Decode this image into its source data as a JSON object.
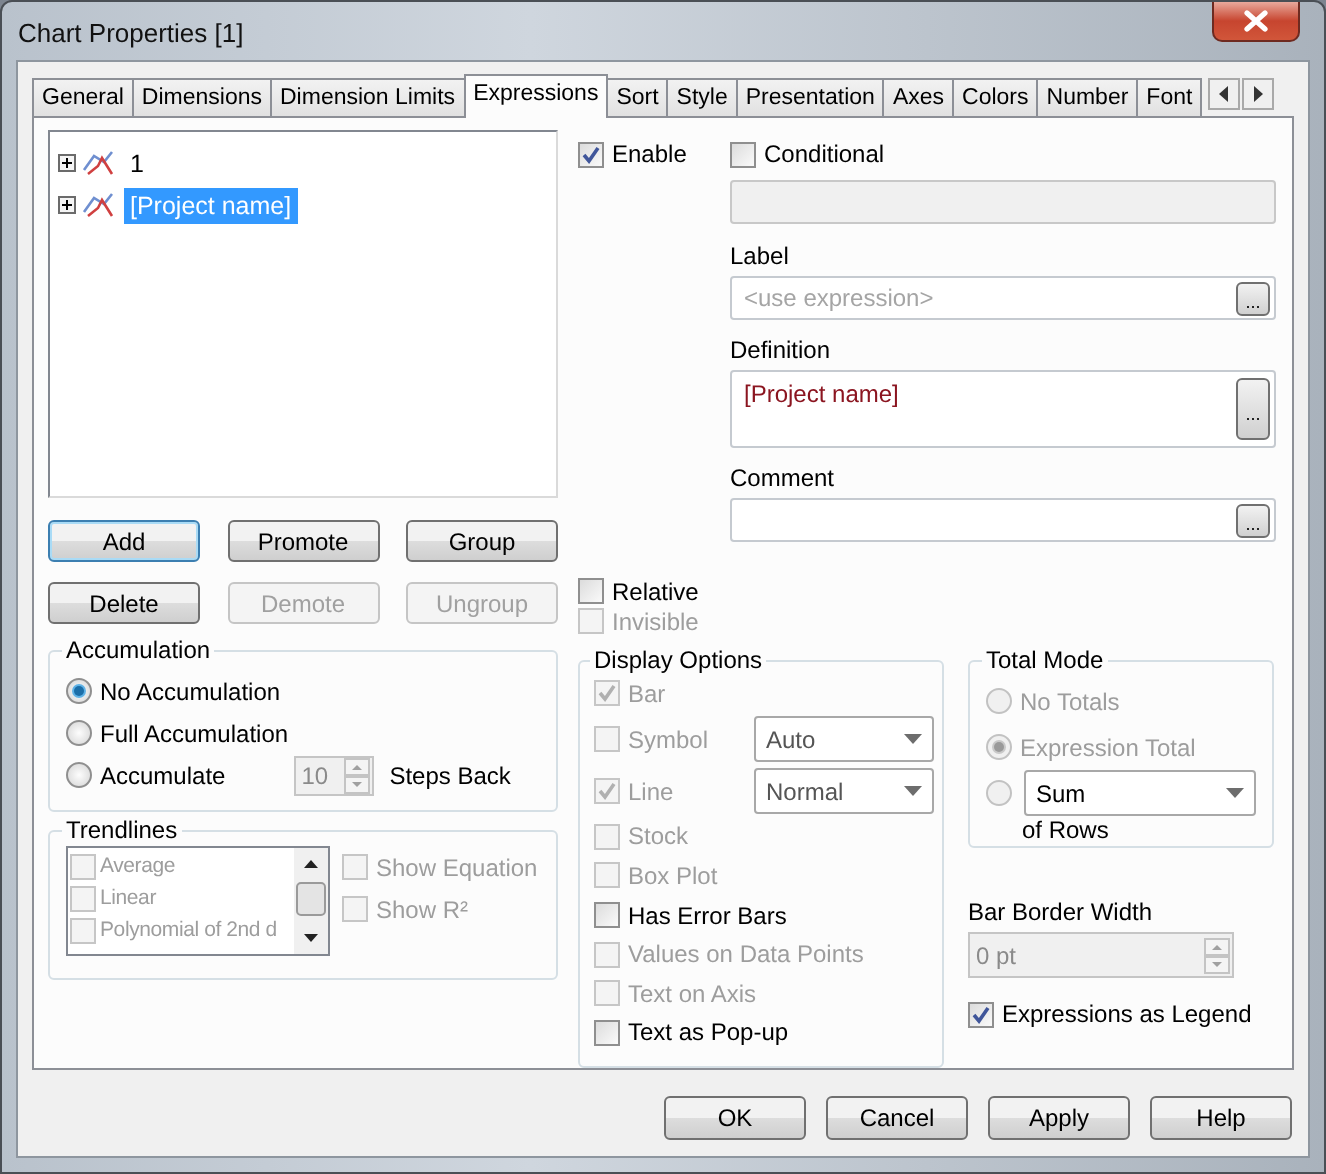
{
  "window": {
    "title": "Chart Properties [1]"
  },
  "tabs": [
    {
      "label": "General",
      "selected": false
    },
    {
      "label": "Dimensions",
      "selected": false
    },
    {
      "label": "Dimension Limits",
      "selected": false
    },
    {
      "label": "Expressions",
      "selected": true
    },
    {
      "label": "Sort",
      "selected": false
    },
    {
      "label": "Style",
      "selected": false
    },
    {
      "label": "Presentation",
      "selected": false
    },
    {
      "label": "Axes",
      "selected": false
    },
    {
      "label": "Colors",
      "selected": false
    },
    {
      "label": "Number",
      "selected": false
    },
    {
      "label": "Font",
      "selected": false
    }
  ],
  "expression_tree": [
    {
      "label": "1",
      "selected": false,
      "expanded": false
    },
    {
      "label": "[Project name]",
      "selected": true,
      "expanded": false
    }
  ],
  "tree_buttons": [
    {
      "label": "Add",
      "disabled": false,
      "focused": true
    },
    {
      "label": "Promote",
      "disabled": false,
      "focused": false
    },
    {
      "label": "Group",
      "disabled": false,
      "focused": false
    },
    {
      "label": "Delete",
      "disabled": false,
      "focused": false
    },
    {
      "label": "Demote",
      "disabled": true,
      "focused": false
    },
    {
      "label": "Ungroup",
      "disabled": true,
      "focused": false
    }
  ],
  "accumulation": {
    "title": "Accumulation",
    "options": [
      {
        "label": "No Accumulation",
        "selected": true
      },
      {
        "label": "Full Accumulation",
        "selected": false
      },
      {
        "label": "Accumulate",
        "selected": false
      }
    ],
    "steps": {
      "value": "10",
      "disabled": true
    },
    "steps_label": "Steps Back"
  },
  "trendlines": {
    "title": "Trendlines",
    "items": [
      {
        "label": "Average",
        "checked": false
      },
      {
        "label": "Linear",
        "checked": false
      },
      {
        "label": "Polynomial of 2nd d",
        "checked": false
      }
    ],
    "options": [
      {
        "label": "Show Equation",
        "checked": false,
        "disabled": true
      },
      {
        "label": "Show R²",
        "checked": false,
        "disabled": true
      }
    ]
  },
  "enable": {
    "label": "Enable",
    "checked": true
  },
  "conditional": {
    "label": "Conditional",
    "checked": false
  },
  "label_field": {
    "caption": "Label",
    "placeholder": "<use expression>",
    "button": "..."
  },
  "definition": {
    "caption": "Definition",
    "value": "[Project name]",
    "button": "..."
  },
  "comment": {
    "caption": "Comment",
    "button": "..."
  },
  "relative": {
    "label": "Relative",
    "checked": false,
    "disabled": false
  },
  "invisible": {
    "label": "Invisible",
    "checked": false,
    "disabled": true
  },
  "display_options": {
    "title": "Display Options",
    "items": [
      {
        "kind": "check",
        "label": "Bar",
        "checked": true,
        "disabled": true
      },
      {
        "kind": "check_select",
        "label": "Symbol",
        "checked": false,
        "disabled": true,
        "select": "Auto"
      },
      {
        "kind": "check_select",
        "label": "Line",
        "checked": true,
        "disabled": true,
        "select": "Normal"
      },
      {
        "kind": "check",
        "label": "Stock",
        "checked": false,
        "disabled": true
      },
      {
        "kind": "check",
        "label": "Box Plot",
        "checked": false,
        "disabled": true
      },
      {
        "kind": "check",
        "label": "Has Error Bars",
        "checked": false,
        "disabled": false
      },
      {
        "kind": "check",
        "label": "Values on Data Points",
        "checked": false,
        "disabled": true
      },
      {
        "kind": "check",
        "label": "Text on Axis",
        "checked": false,
        "disabled": true
      },
      {
        "kind": "check",
        "label": "Text as Pop-up",
        "checked": false,
        "disabled": false
      }
    ]
  },
  "total_mode": {
    "title": "Total Mode",
    "options": [
      {
        "kind": "label",
        "label": "No Totals",
        "selected": false,
        "disabled": true
      },
      {
        "kind": "label",
        "label": "Expression Total",
        "selected": true,
        "disabled": true
      },
      {
        "kind": "select",
        "select": "Sum",
        "selected": false,
        "disabled": true
      }
    ],
    "suffix": "of Rows"
  },
  "bar_border_width": {
    "caption": "Bar Border Width",
    "value": "0 pt",
    "disabled": true
  },
  "expressions_as_legend": {
    "label": "Expressions as Legend",
    "checked": true
  },
  "buttons": [
    {
      "label": "OK"
    },
    {
      "label": "Cancel"
    },
    {
      "label": "Apply"
    },
    {
      "label": "Help"
    }
  ]
}
